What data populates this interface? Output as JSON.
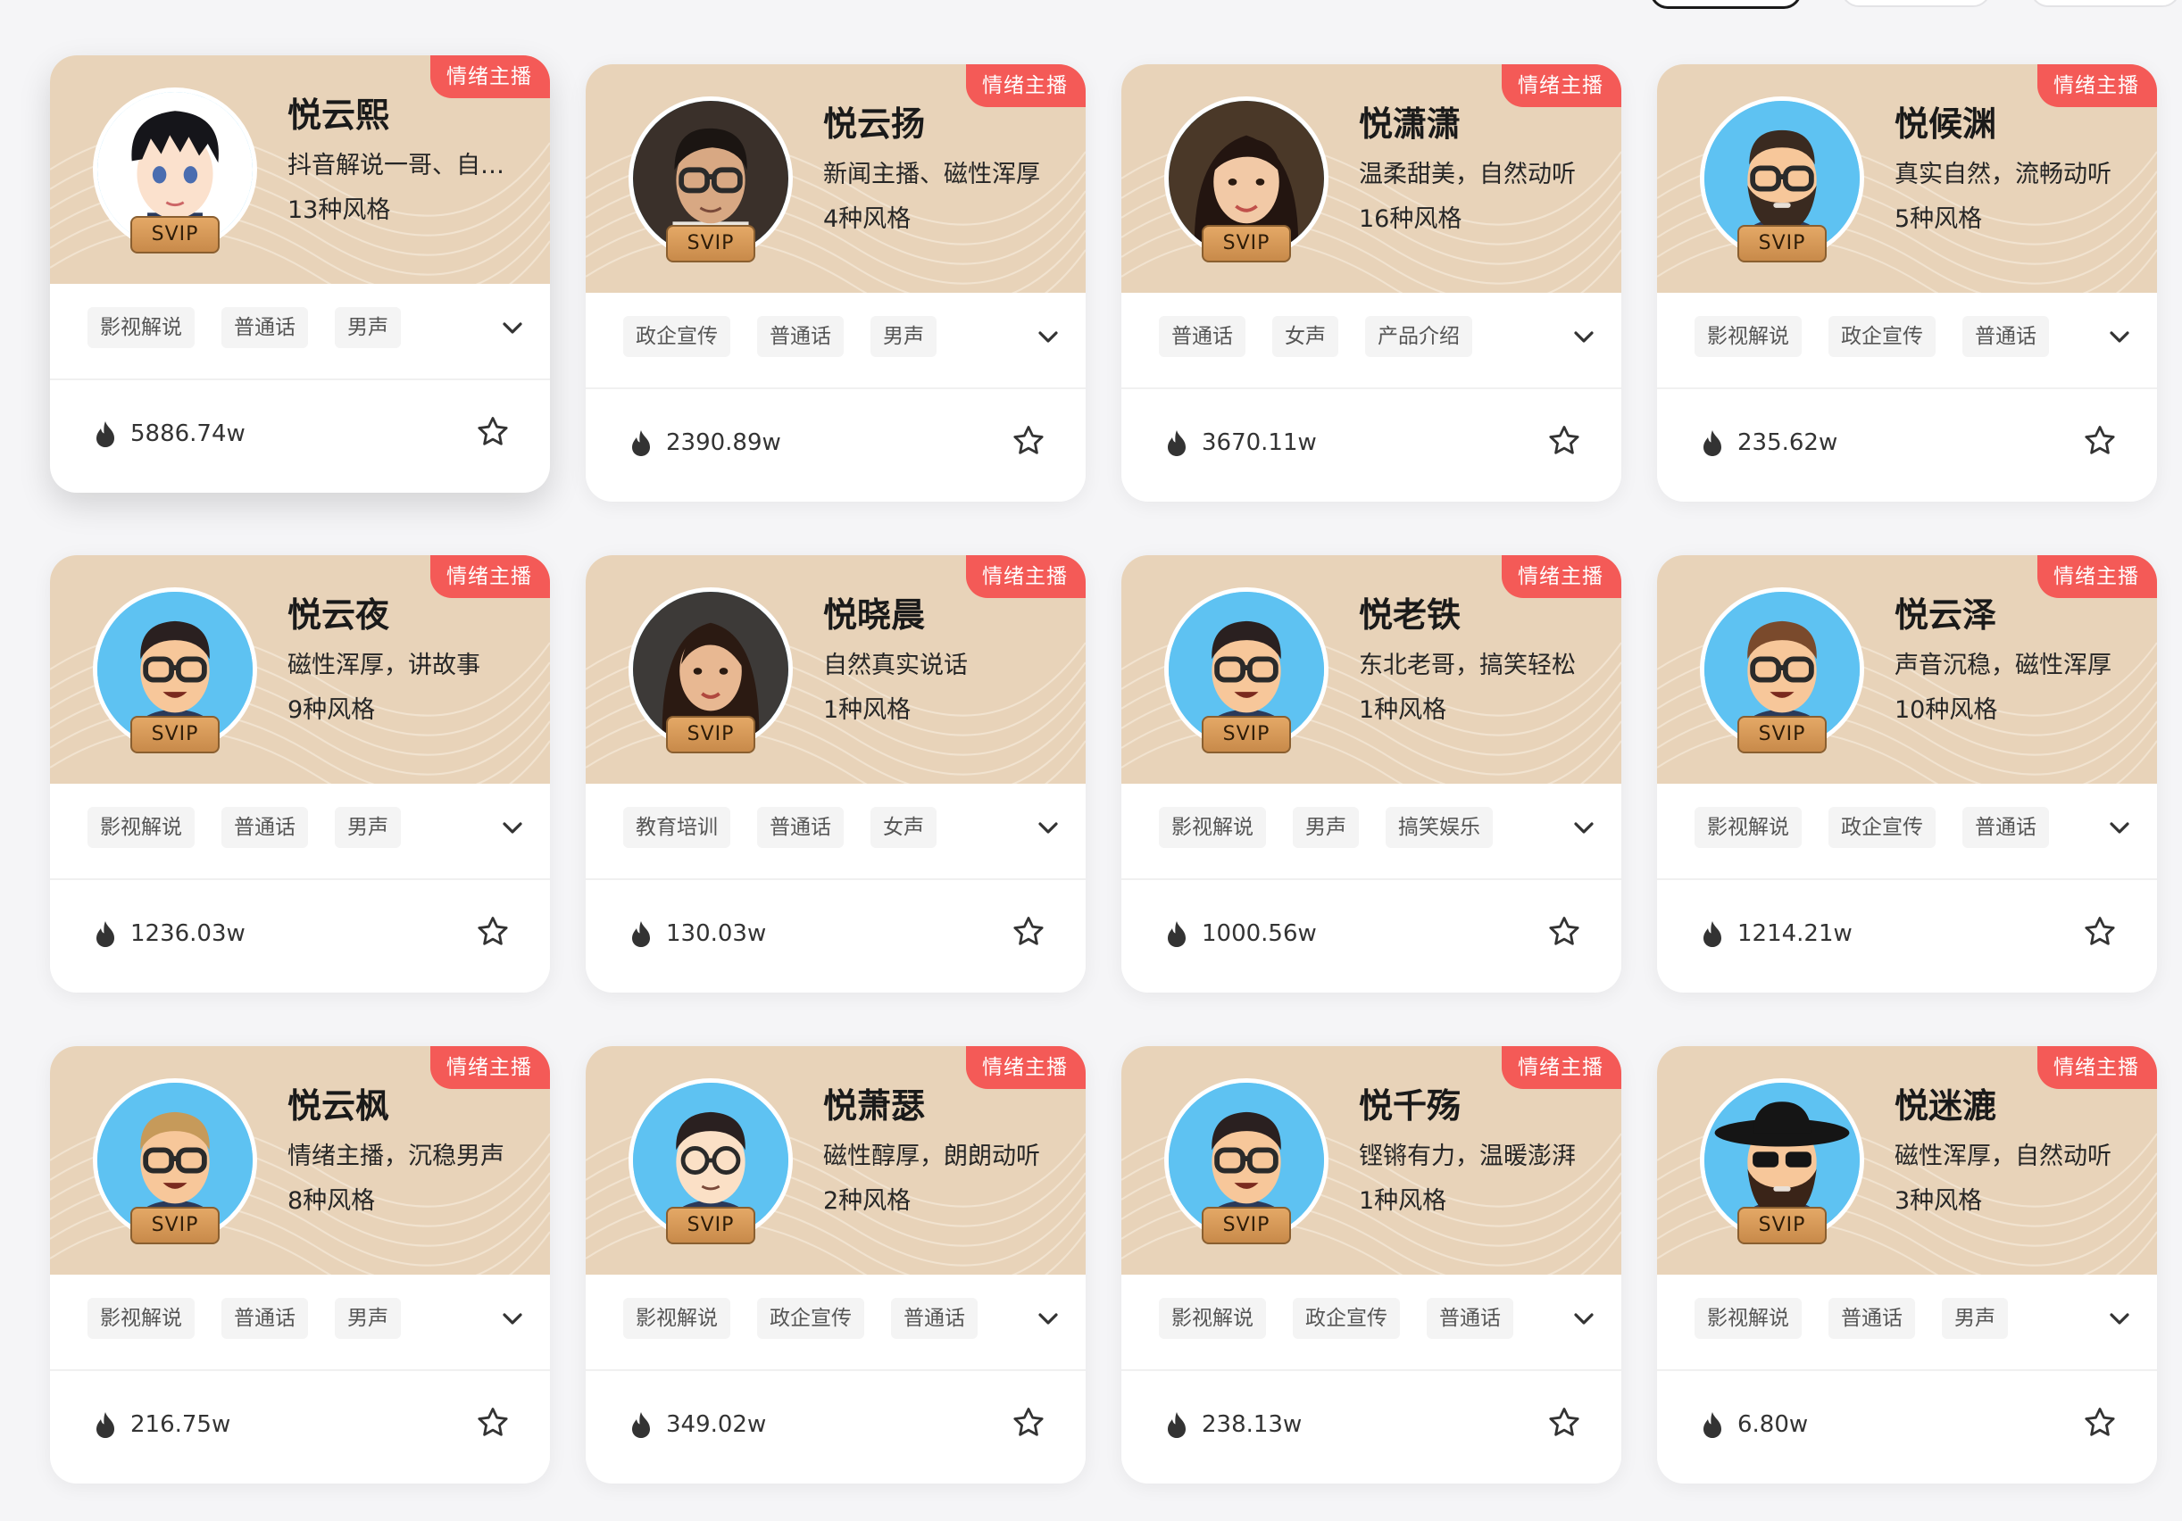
{
  "badge_label": "情绪主播",
  "svip_label": "SVIP",
  "colors": {
    "header_bg": "#e8d3b9",
    "badge_bg": "#f45a57",
    "svip_gold": "#d39a58"
  },
  "filters": [
    {
      "state": "active"
    },
    {
      "state": "inactive"
    },
    {
      "state": "inactive"
    }
  ],
  "cards": [
    {
      "name": "悦云熙",
      "desc": "抖音解说一哥、自然动听",
      "styles": "13种风格",
      "tags": [
        "影视解说",
        "普通话",
        "男声"
      ],
      "plays": "5886.74w",
      "avatar_type": "anime-boy"
    },
    {
      "name": "悦云扬",
      "desc": "新闻主播、磁性浑厚",
      "styles": "4种风格",
      "tags": [
        "政企宣传",
        "普通话",
        "男声"
      ],
      "plays": "2390.89w",
      "avatar_type": "real-man-glasses"
    },
    {
      "name": "悦潇潇",
      "desc": "温柔甜美，自然动听",
      "styles": "16种风格",
      "tags": [
        "普通话",
        "女声",
        "产品介绍"
      ],
      "plays": "3670.11w",
      "avatar_type": "real-woman"
    },
    {
      "name": "悦候渊",
      "desc": "真实自然，流畅动听",
      "styles": "5种风格",
      "tags": [
        "影视解说",
        "政企宣传",
        "普通话"
      ],
      "plays": "235.62w",
      "avatar_type": "cartoon-beard"
    },
    {
      "name": "悦云夜",
      "desc": "磁性浑厚，讲故事",
      "styles": "9种风格",
      "tags": [
        "影视解说",
        "普通话",
        "男声"
      ],
      "plays": "1236.03w",
      "avatar_type": "cartoon-glasses"
    },
    {
      "name": "悦晓晨",
      "desc": "自然真实说话",
      "styles": "1种风格",
      "tags": [
        "教育培训",
        "普通话",
        "女声"
      ],
      "plays": "130.03w",
      "avatar_type": "real-woman-long"
    },
    {
      "name": "悦老铁",
      "desc": "东北老哥，搞笑轻松",
      "styles": "1种风格",
      "tags": [
        "影视解说",
        "男声",
        "搞笑娱乐"
      ],
      "plays": "1000.56w",
      "avatar_type": "cartoon-glasses"
    },
    {
      "name": "悦云泽",
      "desc": "声音沉稳，磁性浑厚",
      "styles": "10种风格",
      "tags": [
        "影视解说",
        "政企宣传",
        "普通话"
      ],
      "plays": "1214.21w",
      "avatar_type": "cartoon-glasses-brown"
    },
    {
      "name": "悦云枫",
      "desc": "情绪主播，沉稳男声",
      "styles": "8种风格",
      "tags": [
        "影视解说",
        "普通话",
        "男声"
      ],
      "plays": "216.75w",
      "avatar_type": "cartoon-glasses-blond"
    },
    {
      "name": "悦萧瑟",
      "desc": "磁性醇厚，朗朗动听",
      "styles": "2种风格",
      "tags": [
        "影视解说",
        "政企宣传",
        "普通话"
      ],
      "plays": "349.02w",
      "avatar_type": "cartoon-round-glasses"
    },
    {
      "name": "悦千殇",
      "desc": "铿锵有力，温暖澎湃",
      "styles": "1种风格",
      "tags": [
        "影视解说",
        "政企宣传",
        "普通话"
      ],
      "plays": "238.13w",
      "avatar_type": "cartoon-glasses"
    },
    {
      "name": "悦迷漉",
      "desc": "磁性浑厚，自然动听",
      "styles": "3种风格",
      "tags": [
        "影视解说",
        "普通话",
        "男声"
      ],
      "plays": "6.80w",
      "avatar_type": "cartoon-hat-beard"
    }
  ]
}
